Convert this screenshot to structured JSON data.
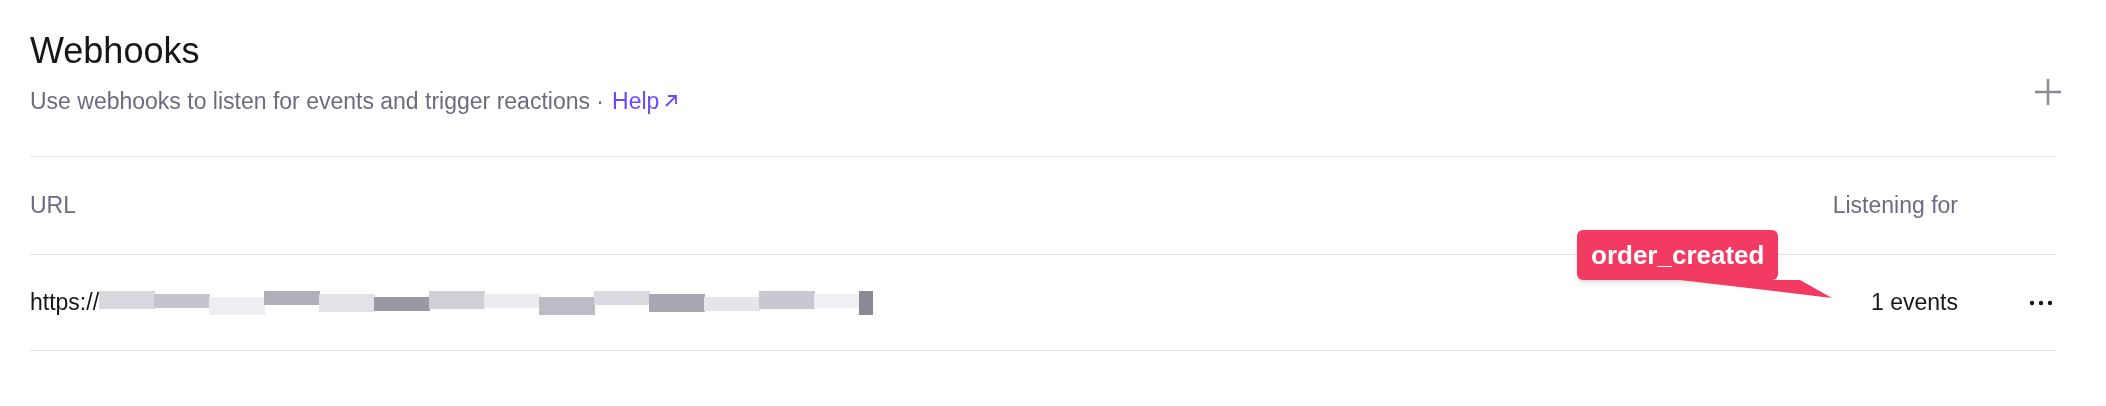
{
  "header": {
    "title": "Webhooks",
    "subtitle": "Use webhooks to listen for events and trigger reactions ·",
    "help_link": "Help"
  },
  "table": {
    "columns": [
      "URL",
      "Listening for"
    ],
    "rows": [
      {
        "url": "https://",
        "events": "1 events",
        "tooltip": "order_created"
      }
    ]
  }
}
